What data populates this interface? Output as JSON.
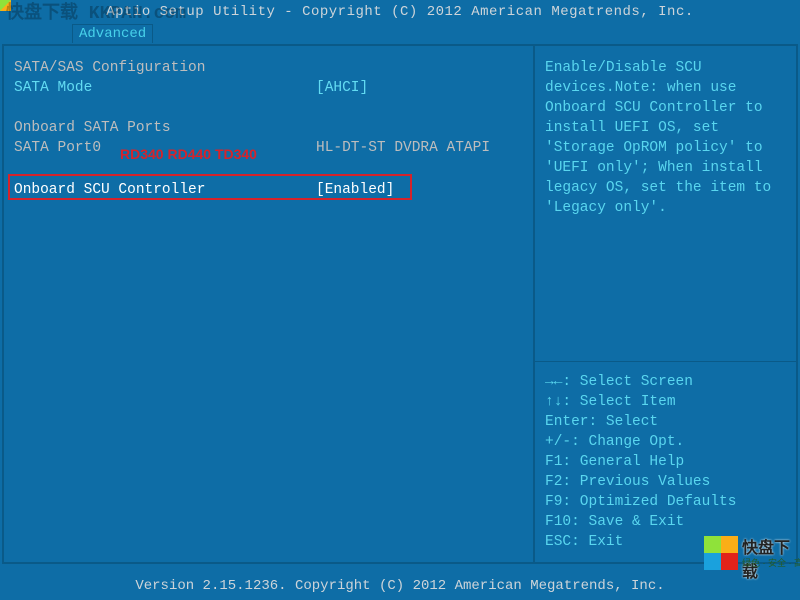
{
  "titlebar": {
    "title": "Aptio Setup Utility - Copyright (C) 2012 American Megatrends, Inc.",
    "bgtext": "快盘下载 KKPAN.com"
  },
  "tabs": {
    "advanced": "Advanced"
  },
  "left": {
    "section1": "SATA/SAS Configuration",
    "sata_mode_label": "SATA Mode",
    "sata_mode_value": "[AHCI]",
    "section2": "Onboard SATA Ports",
    "port0_label": "SATA Port0",
    "port0_value": "HL-DT-ST DVDRA ATAPI",
    "overlay": "RD340 RD440 TD340",
    "scu_label": "Onboard SCU Controller",
    "scu_value": "[Enabled]"
  },
  "right": {
    "help": "Enable/Disable SCU devices.Note: when use Onboard SCU Controller to install UEFI OS, set 'Storage OpROM policy' to 'UEFI only'; When install legacy OS, set the item to 'Legacy only'.",
    "keys": {
      "k1": "→←: Select Screen",
      "k2": "↑↓: Select Item",
      "k3": "Enter: Select",
      "k4": "+/-: Change Opt.",
      "k5": "F1: General Help",
      "k6": "F2: Previous Values",
      "k7": "F9: Optimized Defaults",
      "k8": "F10: Save & Exit",
      "k9": "ESC: Exit"
    }
  },
  "footer": {
    "text": "Version 2.15.1236. Copyright (C) 2012 American Megatrends, Inc."
  },
  "watermark": {
    "line1": "快盘下载",
    "line2": "绿色 · 安全 · 高速"
  }
}
